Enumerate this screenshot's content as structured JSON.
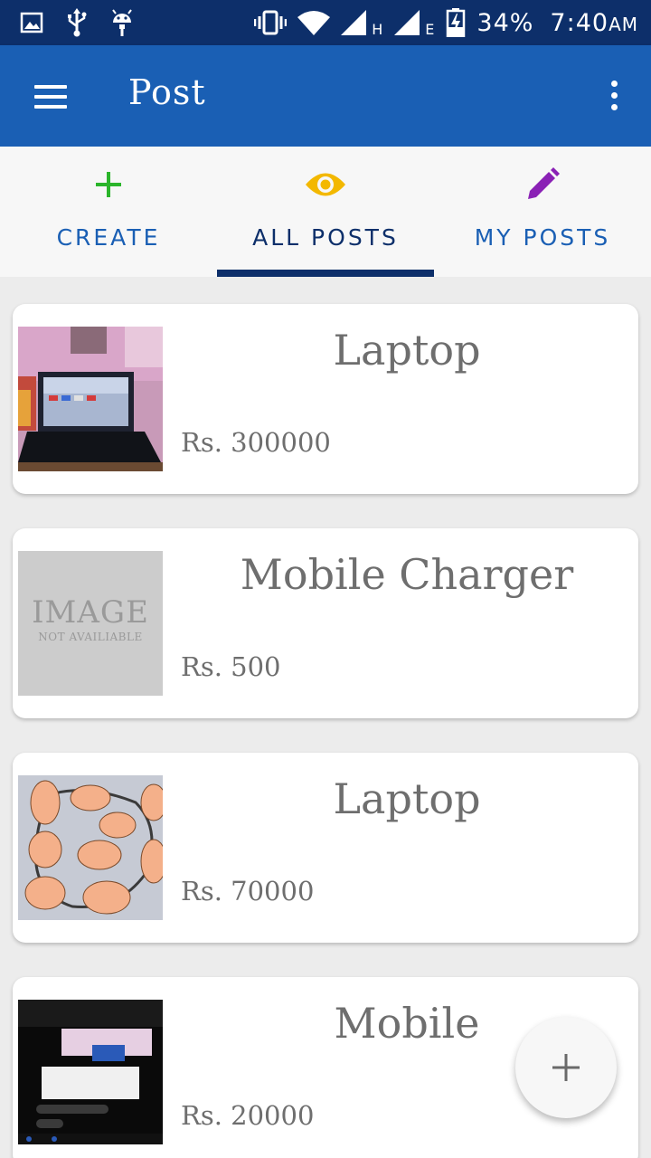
{
  "status_bar": {
    "battery": "34%",
    "time": "7:40",
    "ampm": "AM",
    "net1": "H",
    "net2": "E",
    "icons": [
      "image-icon",
      "usb-icon",
      "android-icon",
      "vibrate-icon",
      "wifi-icon",
      "signal-icon",
      "battery-icon"
    ]
  },
  "app_bar": {
    "title": "Post",
    "menu_icon": "hamburger-icon",
    "overflow_icon": "more-vert-icon",
    "color": "#1a5fb4"
  },
  "tabs": [
    {
      "label": "CREATE",
      "icon": "plus-icon",
      "icon_color": "#2bb52b",
      "active": false
    },
    {
      "label": "ALL POSTS",
      "icon": "eye-icon",
      "icon_color": "#f3b800",
      "active": true
    },
    {
      "label": "MY POSTS",
      "icon": "pencil-icon",
      "icon_color": "#8a21b5",
      "active": false
    }
  ],
  "posts": [
    {
      "title": "Laptop",
      "price": "Rs. 300000",
      "image": "laptop-photo"
    },
    {
      "title": "Mobile Charger",
      "price": "Rs. 500",
      "image": "placeholder",
      "placeholder_line1": "IMAGE",
      "placeholder_line2": "NOT AVAILIABLE"
    },
    {
      "title": "Laptop",
      "price": "Rs. 70000",
      "image": "poster-photo"
    },
    {
      "title": "Mobile",
      "price": "Rs. 20000",
      "image": "screenshot-photo"
    }
  ],
  "fab": {
    "icon": "add-icon"
  }
}
